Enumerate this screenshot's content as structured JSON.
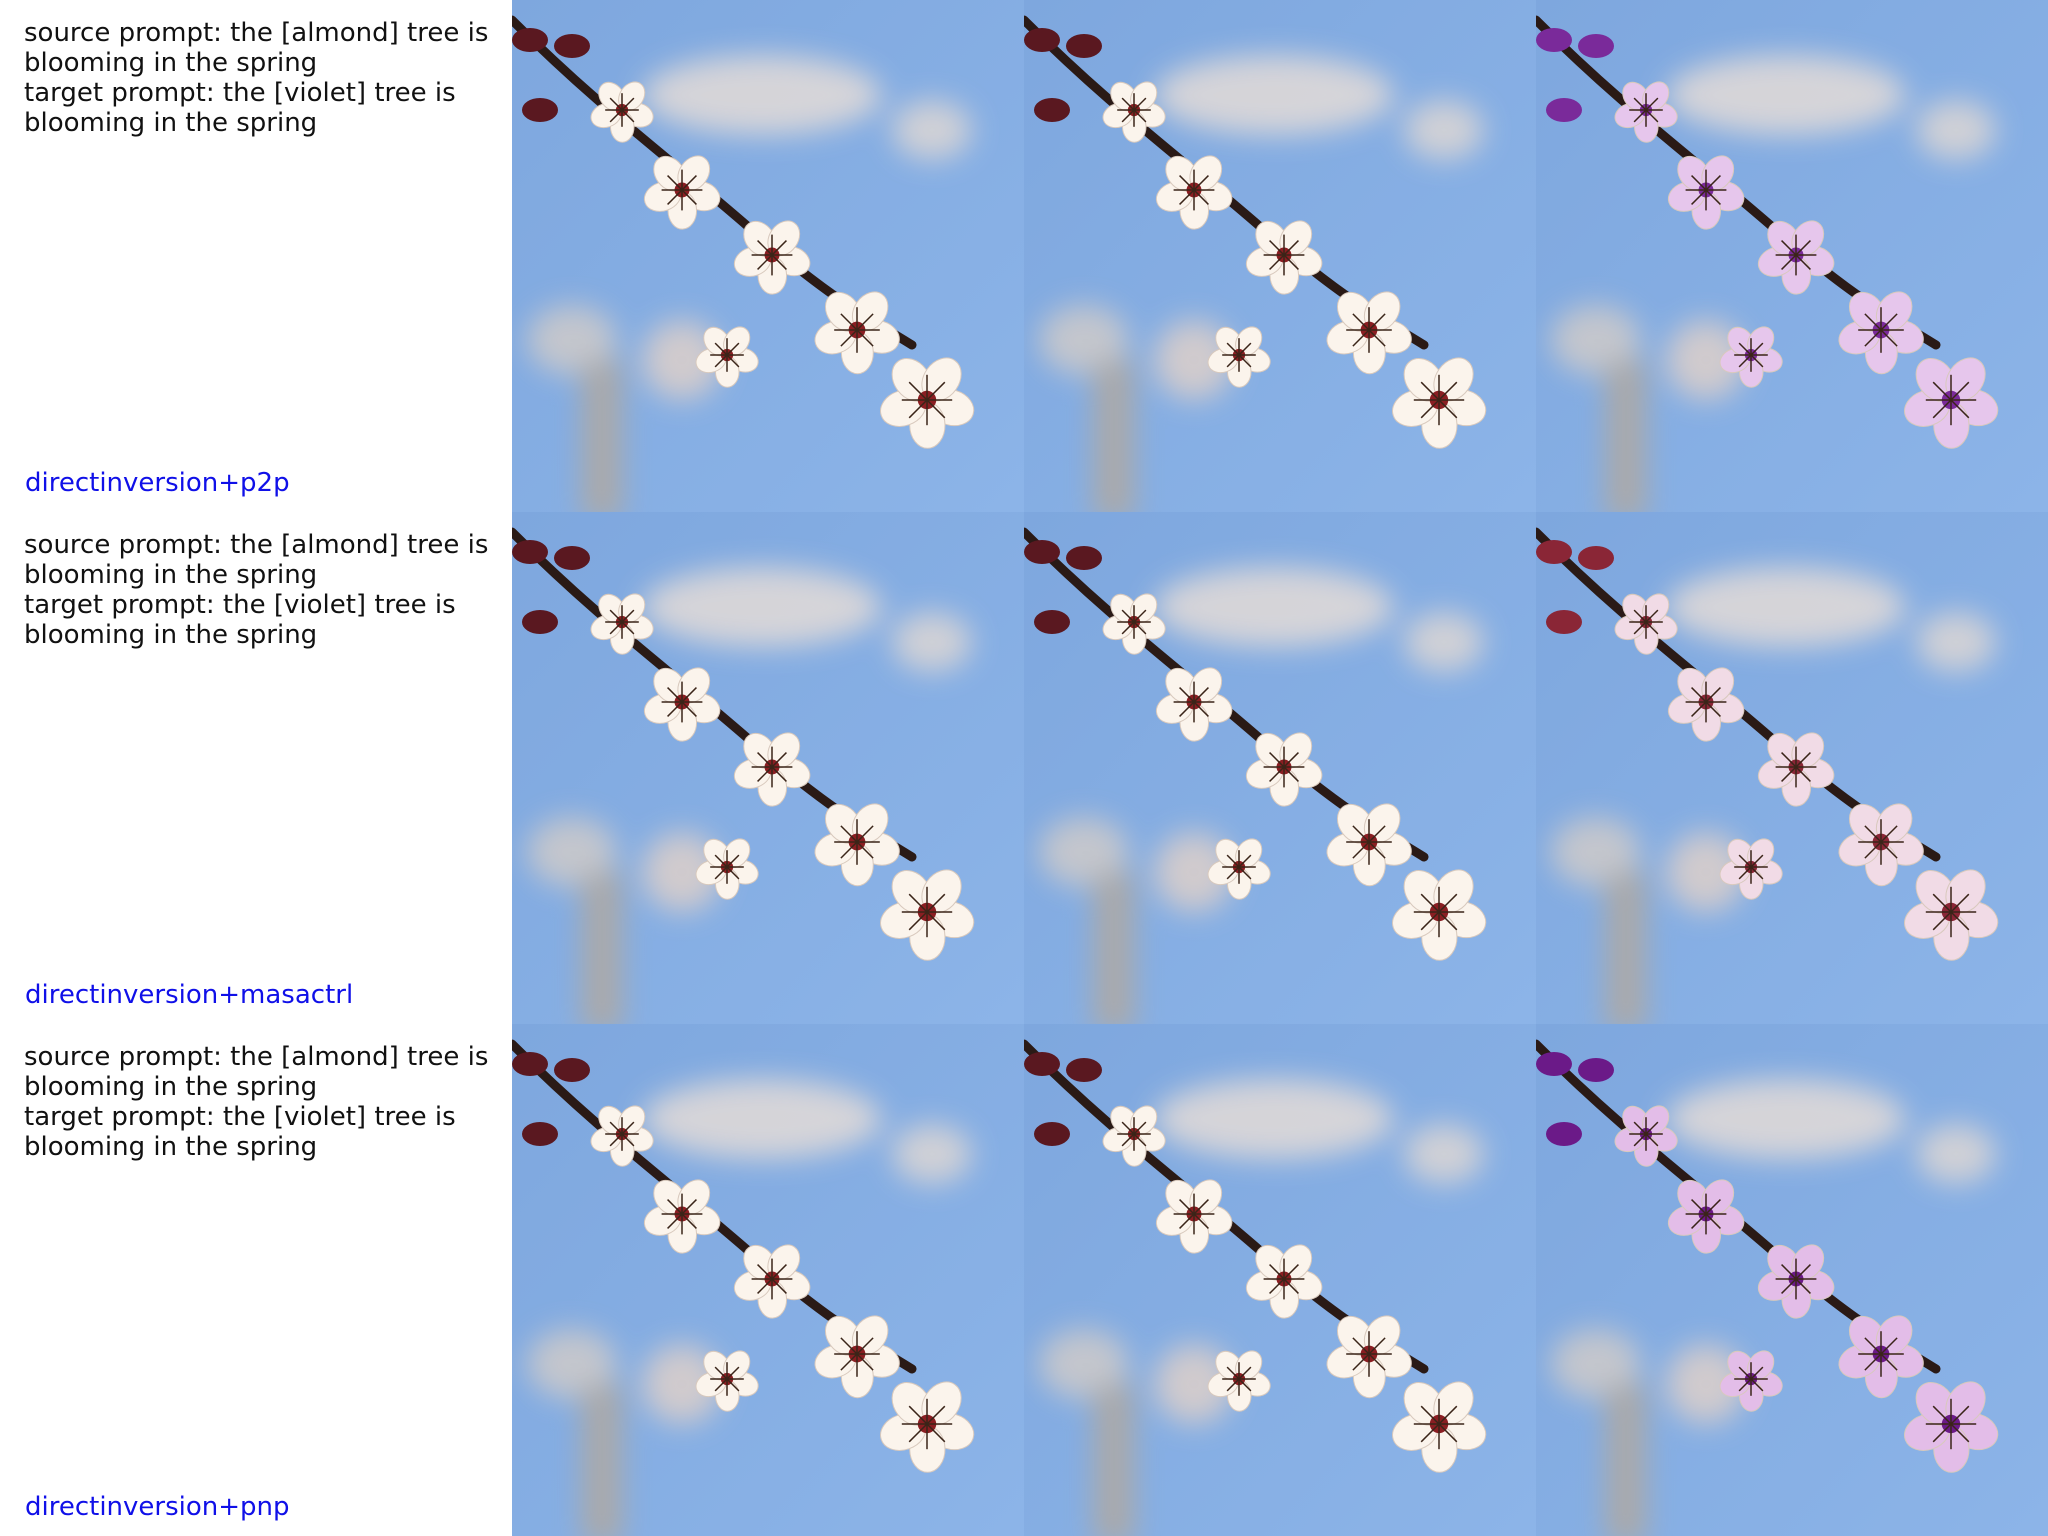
{
  "rows": [
    {
      "source_prompt": "source prompt: the [almond] tree is blooming in the spring",
      "target_prompt": "target prompt: the [violet] tree is blooming in the spring",
      "method": "directinversion+p2p",
      "edited_petal_color": "#e6c6ec",
      "edited_accent_color": "#7a2a9a"
    },
    {
      "source_prompt": "source prompt: the [almond] tree is blooming in the spring",
      "target_prompt": "target prompt: the [violet] tree is blooming in the spring",
      "method": "directinversion+masactrl",
      "edited_petal_color": "#f1dbe6",
      "edited_accent_color": "#8a2636"
    },
    {
      "source_prompt": "source prompt: the [almond] tree is blooming in the spring",
      "target_prompt": "target prompt: the [violet] tree is blooming in the spring",
      "method": "directinversion+pnp",
      "edited_petal_color": "#e3bde8",
      "edited_accent_color": "#6b1a88"
    }
  ],
  "images": {
    "sky_color_top": "#7ea7de",
    "sky_color_bottom": "#8cb4e8",
    "petal_color": "#fbf4ec",
    "branch_color": "#2a1a16",
    "bud_color": "#5a1820"
  }
}
